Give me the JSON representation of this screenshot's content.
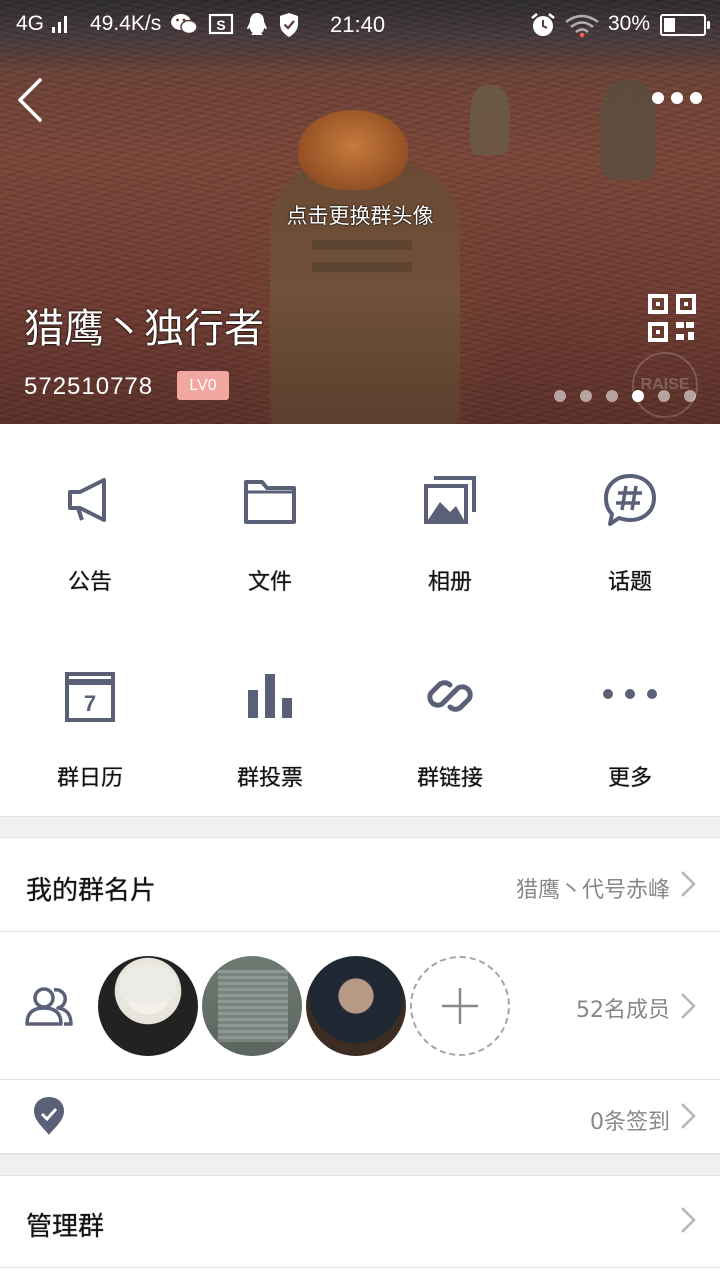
{
  "status_bar": {
    "network": "4G",
    "speed": "49.4K/s",
    "time": "21:40",
    "battery": "30%",
    "battery_level": 0.3
  },
  "hero": {
    "change_avatar_text": "点击更换群头像",
    "group_name": "猎鹰丶独行者",
    "group_id": "572510778",
    "level_badge": "LV0",
    "watermark": "RAISE",
    "carousel": {
      "count": 6,
      "active_index": 3
    }
  },
  "features": [
    {
      "label": "公告",
      "icon": "megaphone-icon"
    },
    {
      "label": "文件",
      "icon": "folder-icon"
    },
    {
      "label": "相册",
      "icon": "photo-album-icon"
    },
    {
      "label": "话题",
      "icon": "hashtag-bubble-icon"
    },
    {
      "label": "群日历",
      "icon": "calendar-icon",
      "calendar_day": "7"
    },
    {
      "label": "群投票",
      "icon": "bar-chart-icon"
    },
    {
      "label": "群链接",
      "icon": "link-icon"
    },
    {
      "label": "更多",
      "icon": "more-dots-icon"
    }
  ],
  "rows": {
    "my_card": {
      "label": "我的群名片",
      "value": "猎鹰丶代号赤峰"
    },
    "members": {
      "icon": "members-icon",
      "value": "52名成员"
    },
    "checkin": {
      "icon": "check-badge-icon",
      "value": "0条签到"
    },
    "manage": {
      "label": "管理群"
    }
  },
  "colors": {
    "icon": "#5b6079",
    "badge": "#f2a8a0",
    "secondary_text": "#888888",
    "separator": "#f0f0f2"
  }
}
